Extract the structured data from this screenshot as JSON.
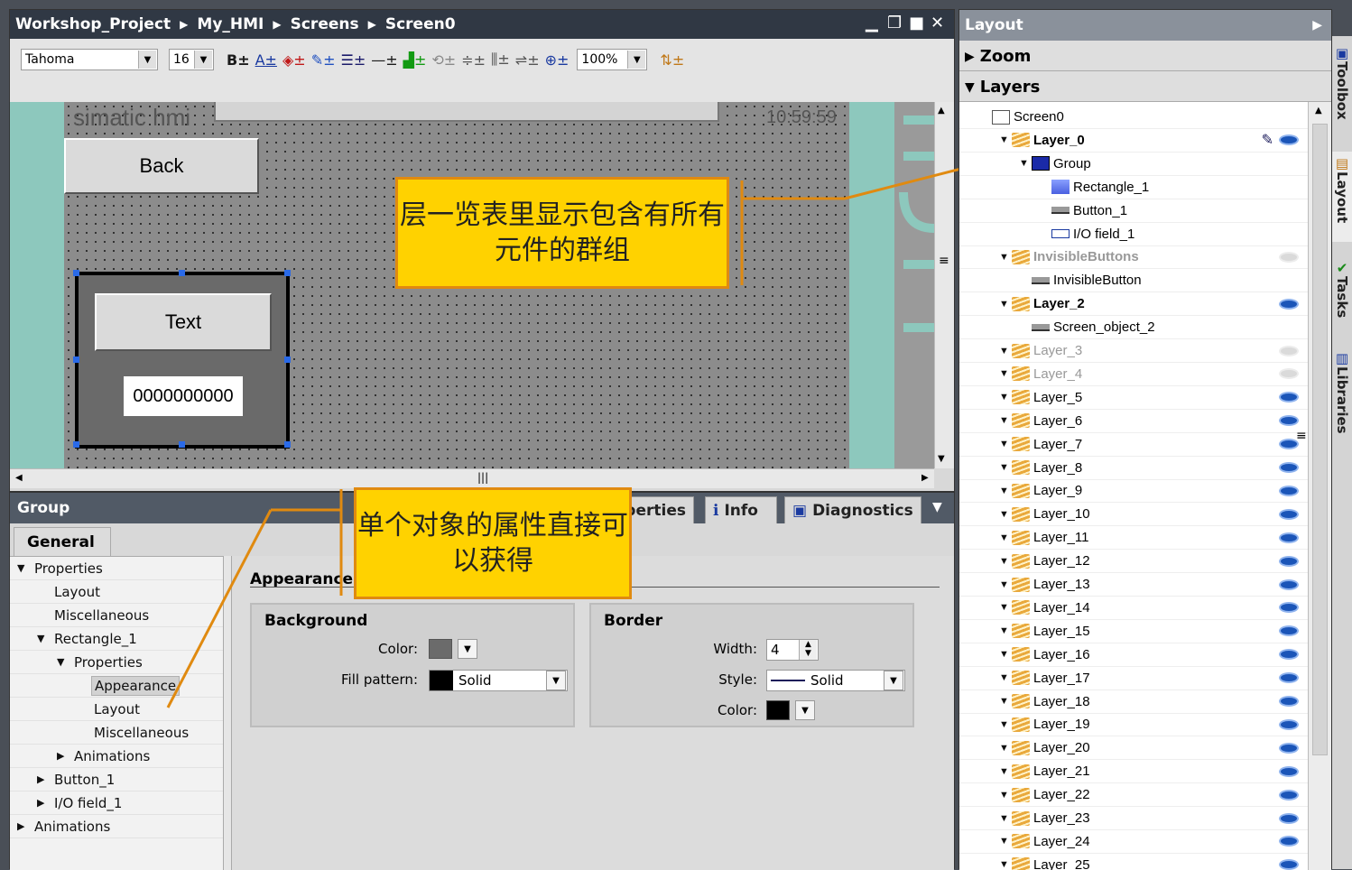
{
  "editor": {
    "breadcrumb": [
      "Workshop_Project",
      "My_HMI",
      "Screens",
      "Screen0"
    ],
    "font_name": "Tahoma",
    "font_size": "16",
    "zoom": "100%",
    "canvas": {
      "logo": "simatic hmi",
      "clock": "10:59:59",
      "back_label": "Back",
      "text_label": "Text",
      "io_value": "0000000000"
    }
  },
  "callouts": {
    "top": "层一览表里显示包含有所有元件的群组",
    "bottom": "单个对象的属性直接可以获得"
  },
  "properties": {
    "title": "Group",
    "tabs": [
      "Properties",
      "Info",
      "Diagnostics"
    ],
    "general_tab": "General",
    "tree": [
      {
        "label": "Properties",
        "level": 0,
        "arrow": "down"
      },
      {
        "label": "Layout",
        "level": 1,
        "arrow": ""
      },
      {
        "label": "Miscellaneous",
        "level": 1,
        "arrow": ""
      },
      {
        "label": "Rectangle_1",
        "level": 1,
        "arrow": "down"
      },
      {
        "label": "Properties",
        "level": 2,
        "arrow": "down"
      },
      {
        "label": "Appearance",
        "level": 3,
        "arrow": "",
        "selected": true
      },
      {
        "label": "Layout",
        "level": 3,
        "arrow": ""
      },
      {
        "label": "Miscellaneous",
        "level": 3,
        "arrow": ""
      },
      {
        "label": "Animations",
        "level": 2,
        "arrow": "right"
      },
      {
        "label": "Button_1",
        "level": 1,
        "arrow": "right"
      },
      {
        "label": "I/O field_1",
        "level": 1,
        "arrow": "right"
      },
      {
        "label": "Animations",
        "level": 0,
        "arrow": "right"
      }
    ],
    "appearance_title": "Appearance",
    "background": {
      "title": "Background",
      "color_label": "Color:",
      "color": "#6b6b6b",
      "fill_label": "Fill pattern:",
      "fill_value": "Solid"
    },
    "border": {
      "title": "Border",
      "width_label": "Width:",
      "width_value": "4",
      "style_label": "Style:",
      "style_value": "Solid",
      "color_label": "Color:",
      "color": "#000000"
    }
  },
  "layout_pane": {
    "title": "Layout",
    "zoom_label": "Zoom",
    "layers_label": "Layers",
    "rows": [
      {
        "label": "Screen0",
        "indent": 0,
        "arrow": "",
        "icon": "screen",
        "bold": false,
        "eye": "none"
      },
      {
        "label": "Layer_0",
        "indent": 1,
        "arrow": "down",
        "icon": "layer",
        "bold": true,
        "eye": "on",
        "edit": true
      },
      {
        "label": "Group",
        "indent": 2,
        "arrow": "down",
        "icon": "group",
        "bold": false,
        "eye": "none"
      },
      {
        "label": "Rectangle_1",
        "indent": 3,
        "arrow": "",
        "icon": "rect",
        "bold": false,
        "eye": "none"
      },
      {
        "label": "Button_1",
        "indent": 3,
        "arrow": "",
        "icon": "button",
        "bold": false,
        "eye": "none"
      },
      {
        "label": "I/O field_1",
        "indent": 3,
        "arrow": "",
        "icon": "io",
        "bold": false,
        "eye": "none"
      },
      {
        "label": "InvisibleButtons",
        "indent": 1,
        "arrow": "down",
        "icon": "layer",
        "bold": true,
        "eye": "off",
        "dim": true
      },
      {
        "label": "InvisibleButton",
        "indent": 2,
        "arrow": "",
        "icon": "button",
        "bold": false,
        "eye": "none"
      },
      {
        "label": "Layer_2",
        "indent": 1,
        "arrow": "down",
        "icon": "layer",
        "bold": true,
        "eye": "on"
      },
      {
        "label": "Screen_object_2",
        "indent": 2,
        "arrow": "",
        "icon": "button",
        "bold": false,
        "eye": "none"
      },
      {
        "label": "Layer_3",
        "indent": 1,
        "arrow": "down",
        "icon": "layer",
        "bold": false,
        "eye": "off",
        "dim": true
      },
      {
        "label": "Layer_4",
        "indent": 1,
        "arrow": "down",
        "icon": "layer",
        "bold": false,
        "eye": "off",
        "dim": true
      },
      {
        "label": "Layer_5",
        "indent": 1,
        "arrow": "down",
        "icon": "layer",
        "bold": false,
        "eye": "on"
      },
      {
        "label": "Layer_6",
        "indent": 1,
        "arrow": "down",
        "icon": "layer",
        "bold": false,
        "eye": "on"
      },
      {
        "label": "Layer_7",
        "indent": 1,
        "arrow": "down",
        "icon": "layer",
        "bold": false,
        "eye": "on"
      },
      {
        "label": "Layer_8",
        "indent": 1,
        "arrow": "down",
        "icon": "layer",
        "bold": false,
        "eye": "on"
      },
      {
        "label": "Layer_9",
        "indent": 1,
        "arrow": "down",
        "icon": "layer",
        "bold": false,
        "eye": "on"
      },
      {
        "label": "Layer_10",
        "indent": 1,
        "arrow": "down",
        "icon": "layer",
        "bold": false,
        "eye": "on"
      },
      {
        "label": "Layer_11",
        "indent": 1,
        "arrow": "down",
        "icon": "layer",
        "bold": false,
        "eye": "on"
      },
      {
        "label": "Layer_12",
        "indent": 1,
        "arrow": "down",
        "icon": "layer",
        "bold": false,
        "eye": "on"
      },
      {
        "label": "Layer_13",
        "indent": 1,
        "arrow": "down",
        "icon": "layer",
        "bold": false,
        "eye": "on"
      },
      {
        "label": "Layer_14",
        "indent": 1,
        "arrow": "down",
        "icon": "layer",
        "bold": false,
        "eye": "on"
      },
      {
        "label": "Layer_15",
        "indent": 1,
        "arrow": "down",
        "icon": "layer",
        "bold": false,
        "eye": "on"
      },
      {
        "label": "Layer_16",
        "indent": 1,
        "arrow": "down",
        "icon": "layer",
        "bold": false,
        "eye": "on"
      },
      {
        "label": "Layer_17",
        "indent": 1,
        "arrow": "down",
        "icon": "layer",
        "bold": false,
        "eye": "on"
      },
      {
        "label": "Layer_18",
        "indent": 1,
        "arrow": "down",
        "icon": "layer",
        "bold": false,
        "eye": "on"
      },
      {
        "label": "Layer_19",
        "indent": 1,
        "arrow": "down",
        "icon": "layer",
        "bold": false,
        "eye": "on"
      },
      {
        "label": "Layer_20",
        "indent": 1,
        "arrow": "down",
        "icon": "layer",
        "bold": false,
        "eye": "on"
      },
      {
        "label": "Layer_21",
        "indent": 1,
        "arrow": "down",
        "icon": "layer",
        "bold": false,
        "eye": "on"
      },
      {
        "label": "Layer_22",
        "indent": 1,
        "arrow": "down",
        "icon": "layer",
        "bold": false,
        "eye": "on"
      },
      {
        "label": "Layer_23",
        "indent": 1,
        "arrow": "down",
        "icon": "layer",
        "bold": false,
        "eye": "on"
      },
      {
        "label": "Layer_24",
        "indent": 1,
        "arrow": "down",
        "icon": "layer",
        "bold": false,
        "eye": "on"
      },
      {
        "label": "Layer_25",
        "indent": 1,
        "arrow": "down",
        "icon": "layer",
        "bold": false,
        "eye": "on"
      }
    ]
  },
  "side_tabs": [
    "Toolbox",
    "Layout",
    "Tasks",
    "Libraries"
  ]
}
